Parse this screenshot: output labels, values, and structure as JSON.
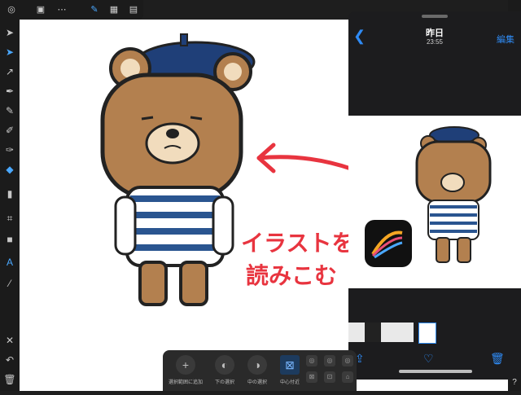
{
  "photos": {
    "title": "昨日",
    "time": "23:55",
    "edit_label": "編集"
  },
  "annotation": {
    "line1": "イラストを",
    "line2": "読みこむ"
  },
  "bottombar": {
    "items": [
      {
        "label": "選択範囲に追加"
      },
      {
        "label": "下の選択"
      },
      {
        "label": "中の選択"
      },
      {
        "label": "中心付近"
      }
    ]
  },
  "help_label": "?"
}
